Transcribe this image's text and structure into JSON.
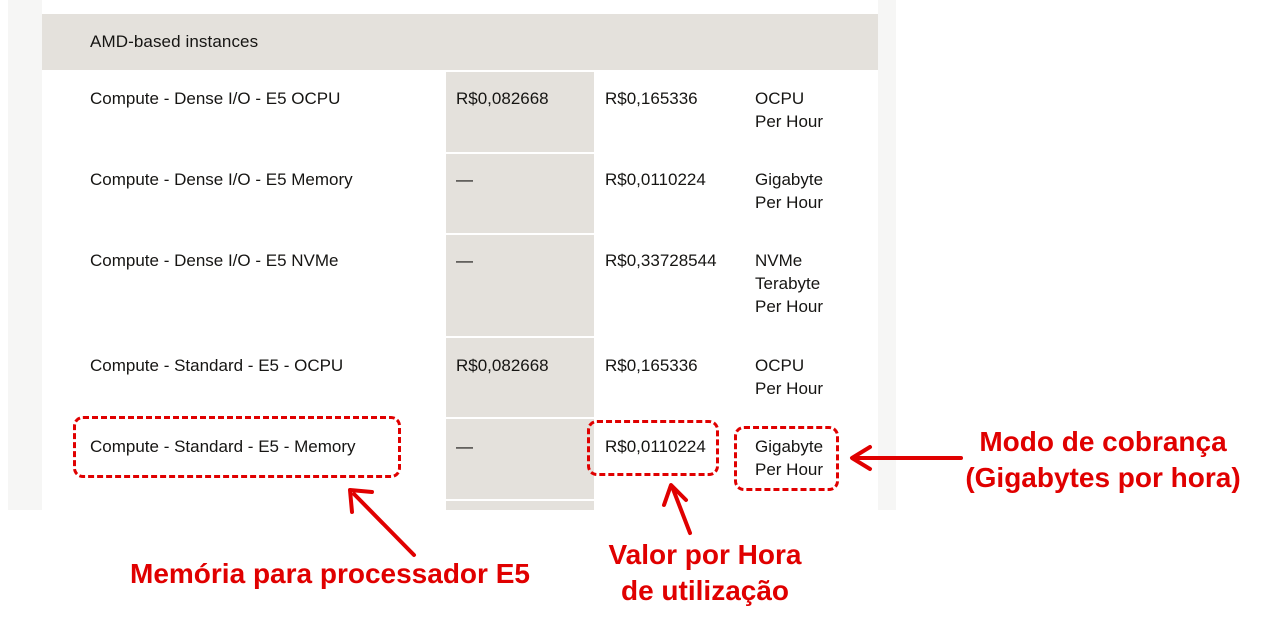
{
  "table": {
    "section_title": "AMD-based instances",
    "rows": [
      {
        "name": "Compute - Dense I/O - E5 OCPU",
        "month": "R$0,082668",
        "hour": "R$0,165336",
        "unit": [
          "OCPU",
          "Per Hour"
        ]
      },
      {
        "name": "Compute - Dense I/O - E5 Memory",
        "month": "—",
        "hour": "R$0,0110224",
        "unit": [
          "Gigabyte",
          "Per Hour"
        ]
      },
      {
        "name": "Compute - Dense I/O - E5 NVMe",
        "month": "—",
        "hour": "R$0,33728544",
        "unit": [
          "NVMe",
          "Terabyte",
          "Per Hour"
        ]
      },
      {
        "name": "Compute - Standard - E5 - OCPU",
        "month": "R$0,082668",
        "hour": "R$0,165336",
        "unit": [
          "OCPU",
          "Per Hour"
        ]
      },
      {
        "name": "Compute - Standard - E5 - Memory",
        "month": "—",
        "hour": "R$0,0110224",
        "unit": [
          "Gigabyte",
          "Per Hour"
        ]
      }
    ]
  },
  "annotations": {
    "memory_label": "Memória para processador E5",
    "hourly_value_label": [
      "Valor por Hora",
      "de utilização"
    ],
    "billing_mode_label": [
      "Modo de cobrança",
      "(Gigabytes por hora)"
    ],
    "color": "#e00000"
  }
}
